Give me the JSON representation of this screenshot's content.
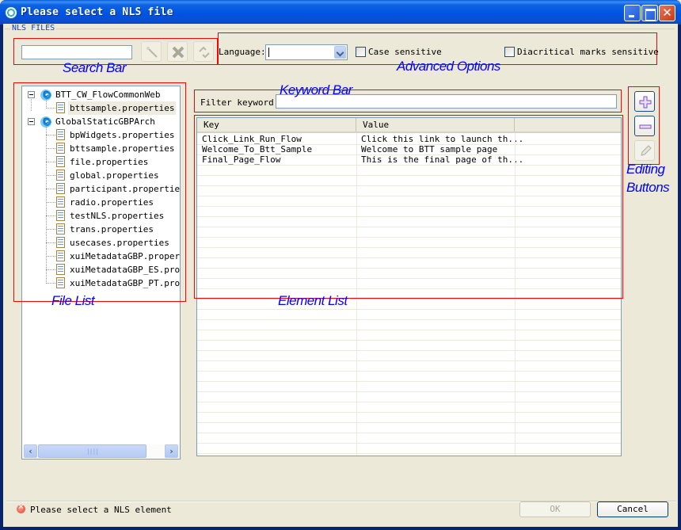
{
  "window": {
    "title": "Please select a NLS file",
    "controls": [
      "minimize",
      "maximize",
      "close"
    ]
  },
  "group": {
    "label": "NLS FILES"
  },
  "annotations": {
    "search_bar": "Search Bar",
    "advanced_options": "Advanced Options",
    "keyword_bar": "Keyword Bar",
    "editing_buttons_line1": "Editing",
    "editing_buttons_line2": "Buttons",
    "file_list": "File List",
    "element_list": "Element List",
    "box_color": "#ff0000",
    "text_color": "#0000ff"
  },
  "search": {
    "value": "",
    "buttons": [
      {
        "icon": "magic-wand-icon",
        "enabled": false
      },
      {
        "icon": "clear-x-icon",
        "enabled": false
      },
      {
        "icon": "refresh-icon",
        "enabled": false
      }
    ]
  },
  "advanced": {
    "language_label": "Language:",
    "language_value": "",
    "case_sensitive_label": "Case sensitive",
    "case_sensitive_checked": false,
    "diacritical_label": "Diacritical marks sensitive",
    "diacritical_checked": false
  },
  "file_tree": {
    "projects": [
      {
        "name": "BTT_CW_FlowCommonWeb",
        "expanded": true,
        "files": [
          "bttsample.properties"
        ]
      },
      {
        "name": "GlobalStaticGBPArch",
        "expanded": true,
        "files": [
          "bpWidgets.properties",
          "bttsample.properties",
          "file.properties",
          "global.properties",
          "participant.properties",
          "radio.properties",
          "testNLS.properties",
          "trans.properties",
          "usecases.properties",
          "xuiMetadataGBP.properties",
          "xuiMetadataGBP_ES.properties",
          "xuiMetadataGBP_PT.properties"
        ]
      }
    ],
    "selected": "BTT_CW_FlowCommonWeb/bttsample.properties"
  },
  "filter": {
    "label": "Filter keyword:",
    "value": ""
  },
  "elements": {
    "columns": [
      "Key",
      "Value",
      ""
    ],
    "rows": [
      {
        "key": "Click_Link_Run_Flow",
        "value": "Click this link to launch th..."
      },
      {
        "key": "Welcome_To_Btt_Sample",
        "value": "Welcome to BTT sample page"
      },
      {
        "key": "Final_Page_Flow",
        "value": "This is the final page of th..."
      }
    ]
  },
  "editing_buttons": [
    {
      "icon": "add-icon",
      "enabled": true
    },
    {
      "icon": "remove-icon",
      "enabled": true
    },
    {
      "icon": "edit-pencil-icon",
      "enabled": false
    }
  ],
  "status": {
    "icon": "error-icon",
    "message": "Please select a NLS element"
  },
  "footer": {
    "ok_label": "OK",
    "ok_enabled": false,
    "cancel_label": "Cancel"
  }
}
